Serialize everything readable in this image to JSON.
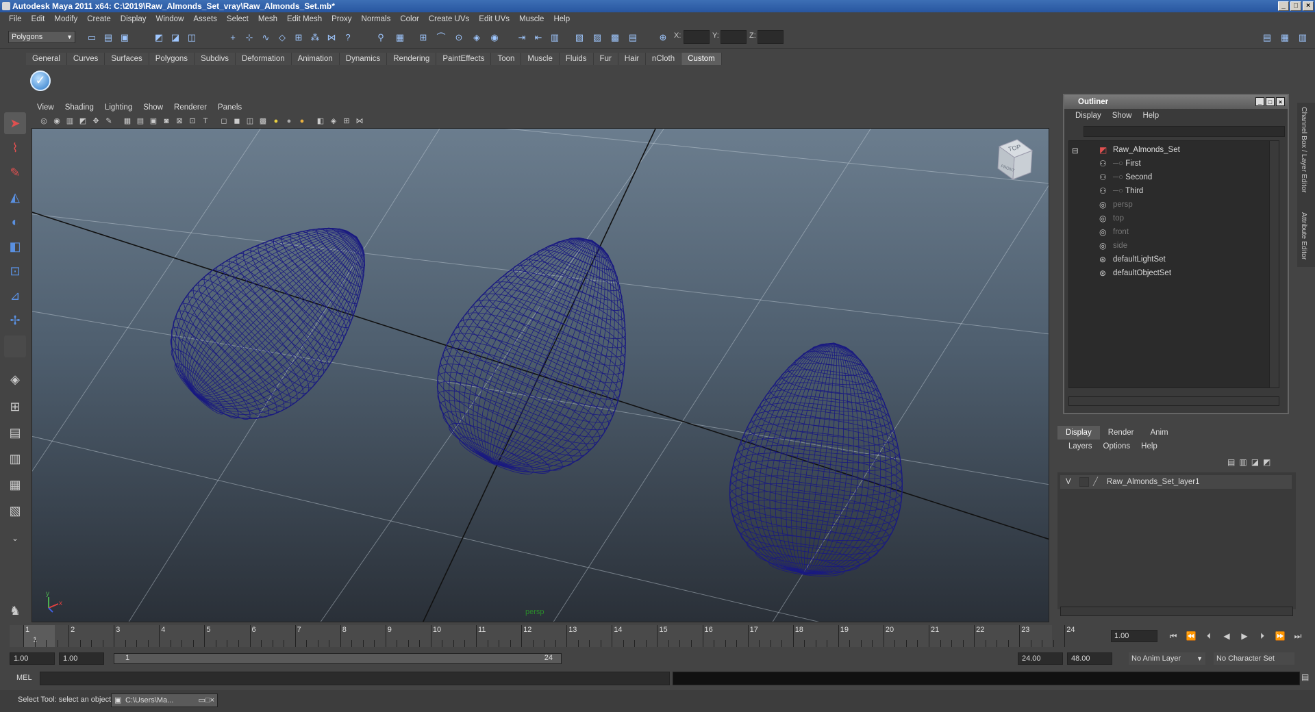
{
  "window": {
    "title": "Autodesk Maya 2011 x64: C:\\2019\\Raw_Almonds_Set_vray\\Raw_Almonds_Set.mb*"
  },
  "menubar": [
    "File",
    "Edit",
    "Modify",
    "Create",
    "Display",
    "Window",
    "Assets",
    "Select",
    "Mesh",
    "Edit Mesh",
    "Proxy",
    "Normals",
    "Color",
    "Create UVs",
    "Edit UVs",
    "Muscle",
    "Help"
  ],
  "statusline": {
    "mode": "Polygons",
    "x_label": "X:",
    "y_label": "Y:",
    "z_label": "Z:"
  },
  "shelf": {
    "tabs": [
      "General",
      "Curves",
      "Surfaces",
      "Polygons",
      "Subdivs",
      "Deformation",
      "Animation",
      "Dynamics",
      "Rendering",
      "PaintEffects",
      "Toon",
      "Muscle",
      "Fluids",
      "Fur",
      "Hair",
      "nCloth",
      "Custom"
    ],
    "active_tab": "Custom"
  },
  "viewport": {
    "menu": [
      "View",
      "Shading",
      "Lighting",
      "Show",
      "Renderer",
      "Panels"
    ],
    "camera_label": "persp",
    "viewcube": {
      "top": "TOP",
      "front": "FRONT"
    },
    "axis": {
      "y": "y",
      "x": "x"
    },
    "wire_color": "#1a1a80"
  },
  "outliner": {
    "title": "Outliner",
    "menu": [
      "Display",
      "Show",
      "Help"
    ],
    "items": [
      {
        "label": "Raw_Almonds_Set",
        "icon": "set-icon",
        "dim": false
      },
      {
        "label": "First",
        "icon": "mesh-icon",
        "dim": false
      },
      {
        "label": "Second",
        "icon": "mesh-icon",
        "dim": false
      },
      {
        "label": "Third",
        "icon": "mesh-icon",
        "dim": false
      },
      {
        "label": "persp",
        "icon": "camera-icon",
        "dim": true
      },
      {
        "label": "top",
        "icon": "camera-icon",
        "dim": true
      },
      {
        "label": "front",
        "icon": "camera-icon",
        "dim": true
      },
      {
        "label": "side",
        "icon": "camera-icon",
        "dim": true
      },
      {
        "label": "defaultLightSet",
        "icon": "set-icon",
        "dim": false
      },
      {
        "label": "defaultObjectSet",
        "icon": "set-icon",
        "dim": false
      }
    ]
  },
  "layers": {
    "tabs": [
      "Display",
      "Render",
      "Anim"
    ],
    "menu": [
      "Layers",
      "Options",
      "Help"
    ],
    "rows": [
      {
        "visible": "V",
        "name": "Raw_Almonds_Set_layer1"
      }
    ]
  },
  "sidetabs": [
    "Channel Box / Layer Editor",
    "Attribute Editor"
  ],
  "timeline": {
    "labels": [
      "1",
      "2",
      "3",
      "4",
      "5",
      "6",
      "7",
      "8",
      "9",
      "10",
      "11",
      "12",
      "13",
      "14",
      "15",
      "16",
      "17",
      "18",
      "19",
      "20",
      "21",
      "22",
      "23",
      "24"
    ],
    "current_frame_label": "1",
    "current_time": "1.00"
  },
  "range": {
    "start": "1.00",
    "anim_start": "1.00",
    "slider_start": "1",
    "slider_end": "24",
    "anim_end": "24.00",
    "end": "48.00",
    "anim_layer": "No Anim Layer",
    "char_set": "No Character Set"
  },
  "cmdline": {
    "label": "MEL"
  },
  "helpline": {
    "text": "Select Tool: select an object",
    "task": "C:\\Users\\Ma..."
  }
}
